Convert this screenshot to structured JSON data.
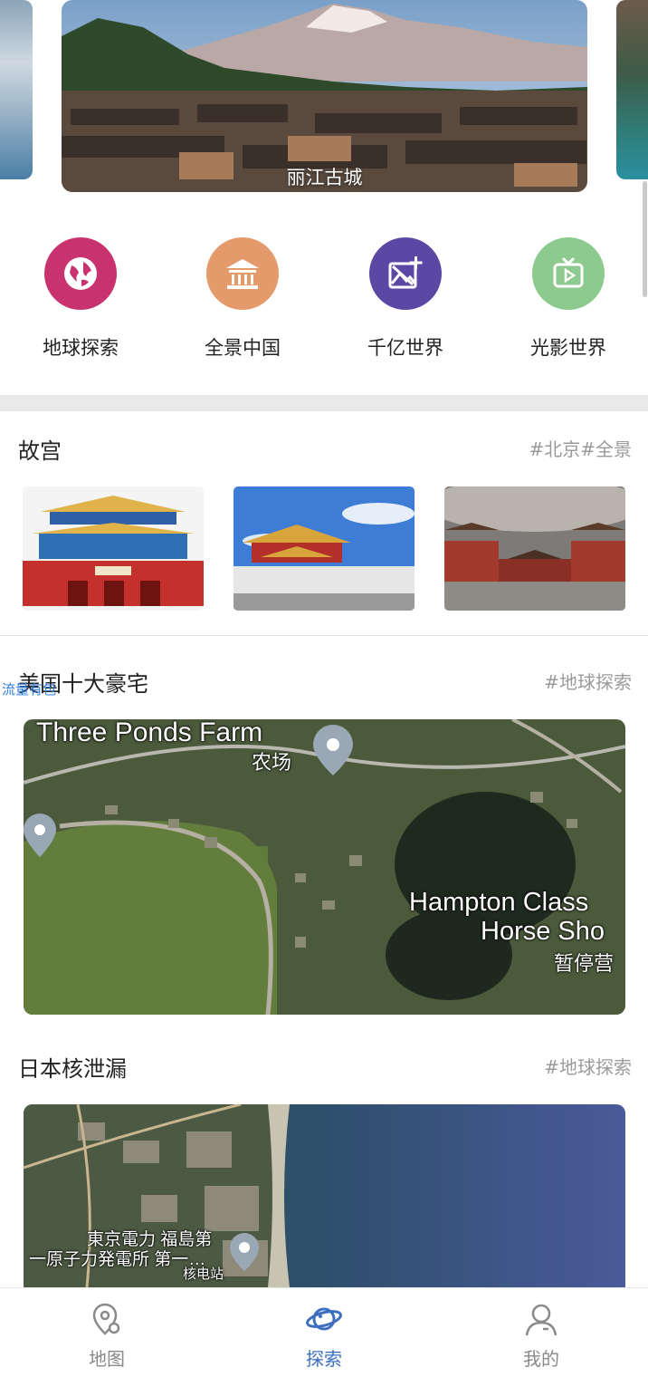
{
  "banner": {
    "caption": "丽江古城"
  },
  "shortcuts": [
    {
      "label": "地球探索",
      "color": "#c7326f",
      "icon": "globe-icon"
    },
    {
      "label": "全景中国",
      "color": "#e59a6b",
      "icon": "temple-icon"
    },
    {
      "label": "千亿世界",
      "color": "#5b47a4",
      "icon": "image-add-icon"
    },
    {
      "label": "光影世界",
      "color": "#8ccb8d",
      "icon": "tv-play-icon"
    }
  ],
  "sections": [
    {
      "title": "故宫",
      "tag": "#北京#全景"
    },
    {
      "title": "美国十大豪宅",
      "tag": "#地球探索"
    },
    {
      "title": "日本核泄漏",
      "tag": "#地球探索"
    }
  ],
  "floating_link": "流量有包",
  "map1": {
    "label_en": "Three Ponds Farm",
    "label_cn": "农场",
    "label_hampton_1": "Hampton Class",
    "label_hampton_2": "Horse Sho",
    "label_paused": "暂停营"
  },
  "map2": {
    "label_1": "東京電力 福島第",
    "label_2": "一原子力発電所 第一…",
    "label_3": "核电站"
  },
  "tabbar": {
    "items": [
      {
        "label": "地图",
        "icon": "map-pin-icon",
        "active": false
      },
      {
        "label": "探索",
        "icon": "planet-icon",
        "active": true
      },
      {
        "label": "我的",
        "icon": "user-icon",
        "active": false
      }
    ],
    "active_color": "#3e6fbf"
  }
}
